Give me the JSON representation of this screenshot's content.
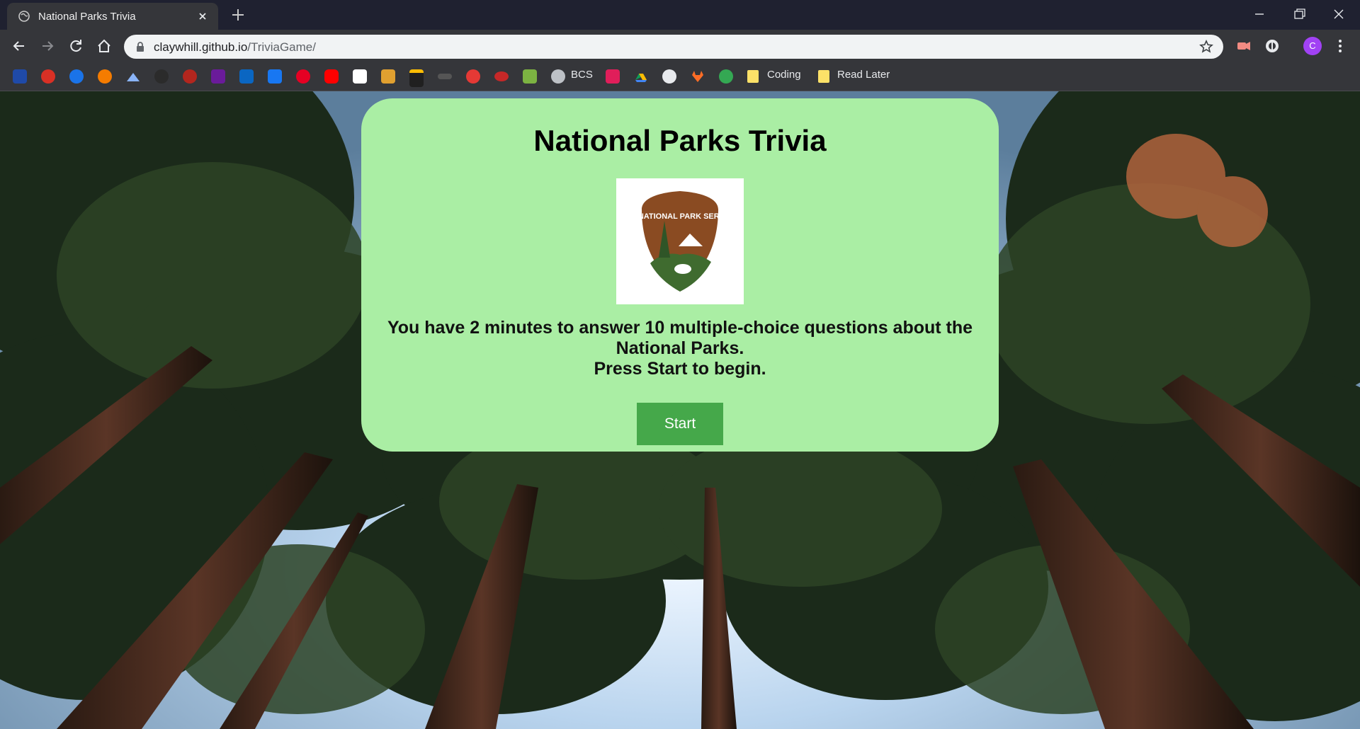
{
  "browser": {
    "tab_title": "National Parks Trivia",
    "url_host": "claywhill.github.io",
    "url_path": "/TriviaGame/",
    "profile_initial": "C",
    "bookmarks_text": [
      {
        "label": "BCS"
      },
      {
        "label": "Coding"
      },
      {
        "label": "Read Later"
      }
    ],
    "bookmark_icons": [
      "usa-icon",
      "target-icon",
      "shield-icon",
      "orange-dot-icon",
      "mountain-icon",
      "dark-circle-icon",
      "camera-icon",
      "envelope-icon",
      "linkedin-icon",
      "facebook-icon",
      "pinterest-icon",
      "youtube-icon",
      "amazon-icon",
      "tools-icon",
      "suitcase-icon",
      "bar-icon",
      "flash-icon",
      "u-icon",
      "money-icon",
      "globe-icon",
      "slack-icon",
      "drive-icon",
      "github-icon",
      "gitlab-icon",
      "cube-icon"
    ]
  },
  "card": {
    "title": "National Parks Trivia",
    "logo_text": "NATIONAL PARK SERVICE",
    "line1": "You have 2 minutes to answer 10 multiple-choice questions about the",
    "line2": "National Parks.",
    "line3": "Press Start to begin.",
    "start_label": "Start"
  },
  "colors": {
    "card_bg": "#aaeea4",
    "button_bg": "#45a84a",
    "chrome_bg": "#35363a",
    "tabstrip_bg": "#1f2130"
  }
}
